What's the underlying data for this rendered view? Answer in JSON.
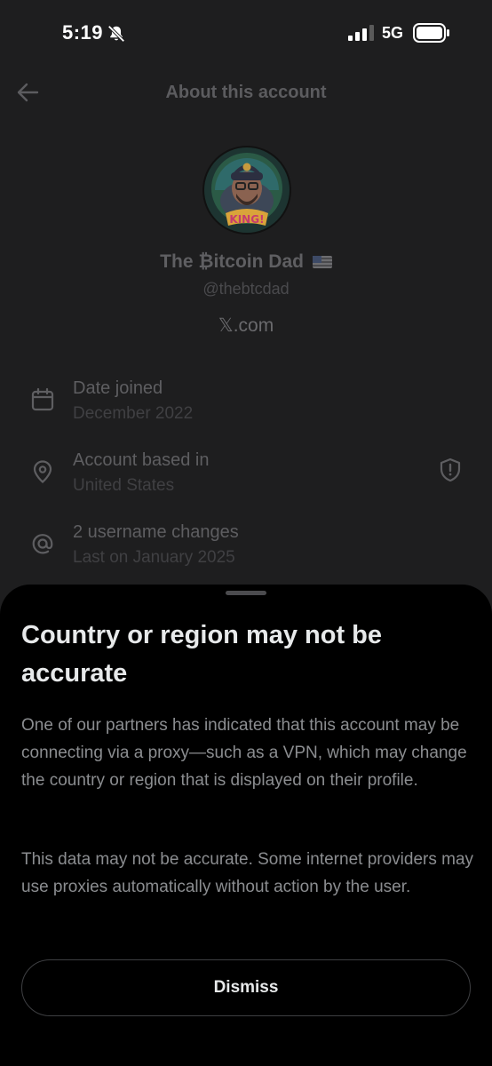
{
  "status": {
    "time": "5:19",
    "network": "5G"
  },
  "header": {
    "title": "About this account"
  },
  "profile": {
    "name": "The ₿itcoin Dad",
    "handle": "@thebtcdad",
    "site": "𝕏.com"
  },
  "details": [
    {
      "icon": "calendar-icon",
      "label": "Date joined",
      "value": "December 2022"
    },
    {
      "icon": "location-pin-icon",
      "label": "Account based in",
      "value": "United States",
      "badge_icon": "shield-warning-icon"
    },
    {
      "icon": "at-sign-icon",
      "label": "2 username changes",
      "value": "Last on January 2025"
    }
  ],
  "sheet": {
    "title": "Country or region may not be accurate",
    "paragraph1": "One of our partners has indicated that this account may be connecting via a proxy—such as a VPN, which may change the country or region that is displayed on their profile.",
    "paragraph2": "This data may not be accurate. Some internet providers may use proxies automatically without action by the user.",
    "dismiss_label": "Dismiss"
  },
  "colors": {
    "background": "#1e1e1f",
    "sheet": "#000000",
    "text_primary": "#e7e9ea",
    "text_secondary": "#8b8d90"
  }
}
